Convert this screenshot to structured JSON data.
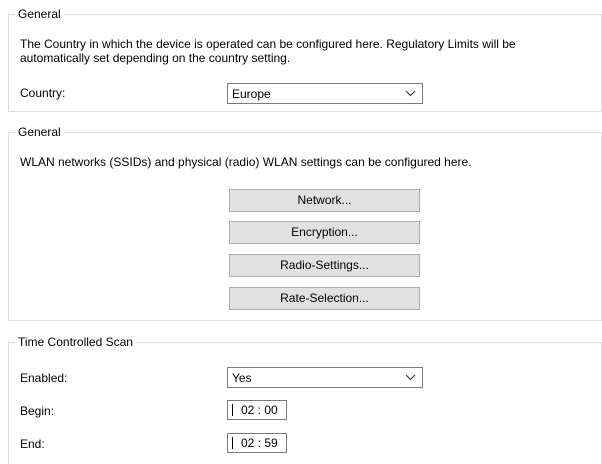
{
  "country_group": {
    "legend": "General",
    "description_line1": "The Country in which the device is operated can be configured here. Regulatory Limits will be",
    "description_line2": "automatically set depending on the country setting.",
    "country_label": "Country:",
    "country_value": "Europe"
  },
  "wlan_group": {
    "legend": "General",
    "description": "WLAN networks (SSIDs) and physical (radio) WLAN settings can be configured here.",
    "buttons": {
      "network": "Network...",
      "encryption": "Encryption...",
      "radio_settings": "Radio-Settings...",
      "rate_selection": "Rate-Selection..."
    }
  },
  "scan_group": {
    "legend": "Time Controlled Scan",
    "enabled_label": "Enabled:",
    "enabled_value": "Yes",
    "begin_label": "Begin:",
    "begin_value": "02 : 00",
    "end_label": "End:",
    "end_value": "02 : 59"
  },
  "icons": {
    "dropdown": "chevron-down-icon"
  }
}
